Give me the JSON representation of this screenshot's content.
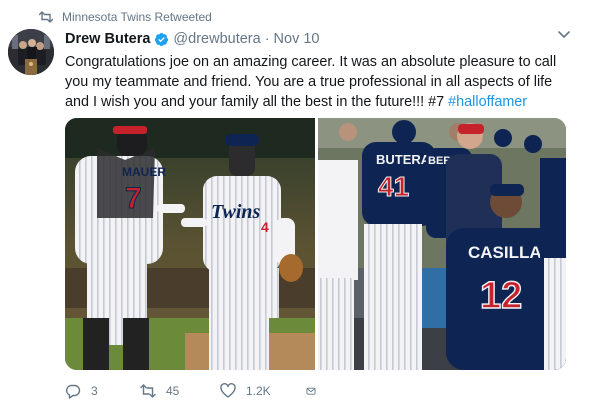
{
  "retweet_context": {
    "icon": "retweet-icon",
    "text": "Minnesota Twins Retweeted"
  },
  "author": {
    "name": "Drew Butera",
    "verified": true,
    "handle": "@drewbutera",
    "separator": "·",
    "date": "Nov 10"
  },
  "tweet": {
    "text": "Congratulations joe on an amazing career. It was an absolute pleasure to call you my teammate and friend. You are a true professional in all aspects of life and I wish you and your family all the best in the future!!!  #7 ",
    "hashtag": "#halloffamer"
  },
  "media": {
    "photo_left": {
      "jersey_front_text": "Twins",
      "jersey_number": "4",
      "back_name": "MAUER",
      "back_number": "7"
    },
    "photo_right": {
      "player1_name": "BUTERA",
      "player1_number": "41",
      "player2_name": "CASILLA",
      "player2_number": "12",
      "partial_name": "BER"
    }
  },
  "actions": {
    "reply_count": "3",
    "retweet_count": "45",
    "like_count": "1.2K",
    "dm_icon": "envelope-icon"
  },
  "colors": {
    "link": "#1b95e0",
    "meta": "#657786",
    "text": "#14171a",
    "verified": "#1da1f2"
  }
}
